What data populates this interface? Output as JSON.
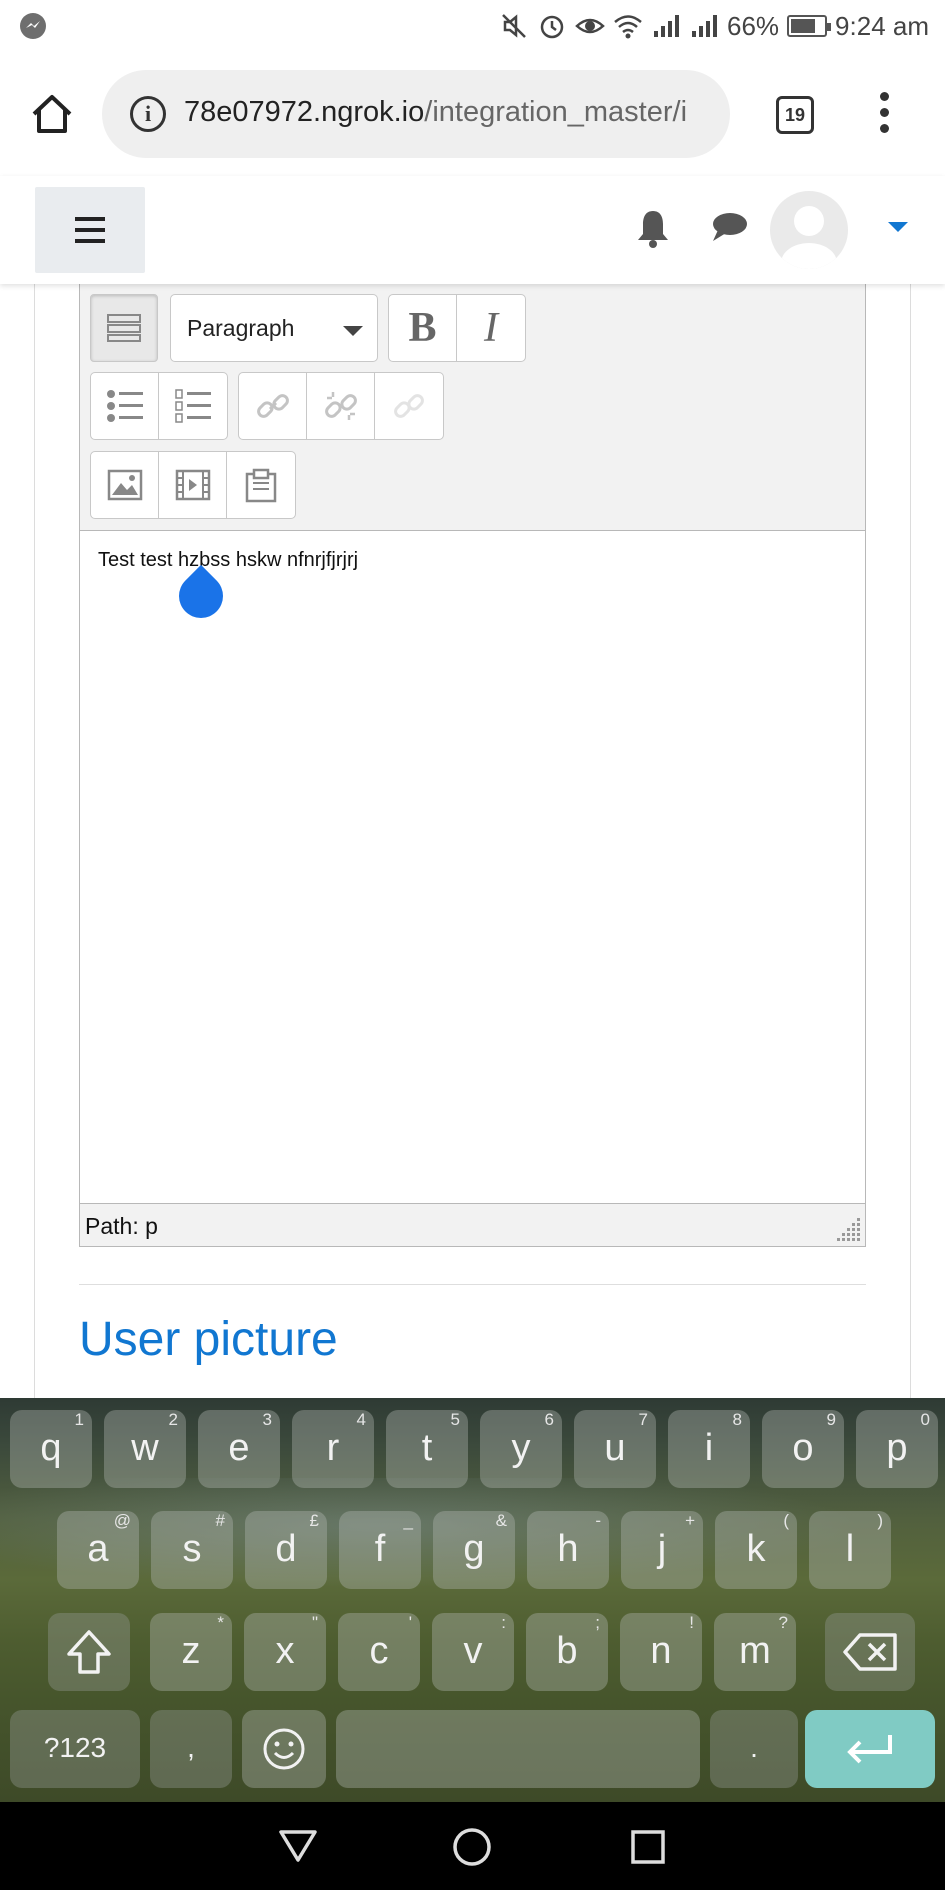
{
  "status_bar": {
    "battery": "66%",
    "battery_level": 0.66,
    "time": "9:24 am",
    "icons": [
      "messenger-icon",
      "mute-icon",
      "alarm-icon",
      "eye-icon",
      "wifi-icon",
      "signal-icon",
      "signal-icon",
      "battery-icon"
    ]
  },
  "browser": {
    "url_host": "78e07972.ngrok.io",
    "url_path": "/integration_master/i",
    "tab_count": "19"
  },
  "editor": {
    "block_format": "Paragraph",
    "bold_label": "B",
    "italic_label": "I",
    "content": "Test test hzbss hskw nfnrjfjrjrj",
    "path_label": "Path: p"
  },
  "section": {
    "title": "User picture"
  },
  "keyboard": {
    "row1": [
      [
        "q",
        "1"
      ],
      [
        "w",
        "2"
      ],
      [
        "e",
        "3"
      ],
      [
        "r",
        "4"
      ],
      [
        "t",
        "5"
      ],
      [
        "y",
        "6"
      ],
      [
        "u",
        "7"
      ],
      [
        "i",
        "8"
      ],
      [
        "o",
        "9"
      ],
      [
        "p",
        "0"
      ]
    ],
    "row2": [
      [
        "a",
        "@"
      ],
      [
        "s",
        "#"
      ],
      [
        "d",
        "£"
      ],
      [
        "f",
        "_"
      ],
      [
        "g",
        "&"
      ],
      [
        "h",
        "-"
      ],
      [
        "j",
        "+"
      ],
      [
        "k",
        "("
      ],
      [
        "l",
        ")"
      ]
    ],
    "row3": [
      [
        "z",
        "*"
      ],
      [
        "x",
        "\""
      ],
      [
        "c",
        "'"
      ],
      [
        "v",
        ":"
      ],
      [
        "b",
        ";"
      ],
      [
        "n",
        "!"
      ],
      [
        "m",
        "?"
      ]
    ],
    "symbols_label": "?123",
    "comma_label": ",",
    "period_label": "."
  },
  "colors": {
    "accent": "#1177d1",
    "cursor": "#1a73e8",
    "enter_key": "#80cbc4"
  }
}
